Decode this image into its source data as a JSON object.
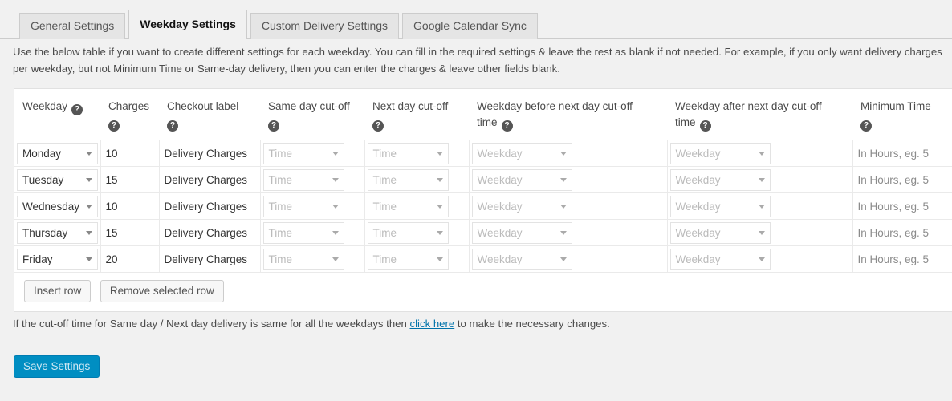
{
  "tabs": [
    {
      "label": "General Settings",
      "active": false
    },
    {
      "label": "Weekday Settings",
      "active": true
    },
    {
      "label": "Custom Delivery Settings",
      "active": false
    },
    {
      "label": "Google Calendar Sync",
      "active": false
    }
  ],
  "intro": "Use the below table if you want to create different settings for each weekday. You can fill in the required settings & leave the rest as blank if not needed. For example, if you only want delivery charges per weekday, but not Minimum Time or Same-day delivery, then you can enter the charges & leave other fields blank.",
  "table": {
    "headers": [
      {
        "label": "Weekday",
        "help": "help-icon"
      },
      {
        "label": "Charges",
        "help": "help-icon"
      },
      {
        "label": "Checkout label",
        "help": "help-icon"
      },
      {
        "label": "Same day cut-off",
        "help": "help-icon"
      },
      {
        "label": "Next day cut-off",
        "help": "help-icon"
      },
      {
        "label": "Weekday before next day cut-off time",
        "help": "help-icon"
      },
      {
        "label": "Weekday after next day cut-off time",
        "help": "help-icon"
      },
      {
        "label": "Minimum Time",
        "help": "help-icon"
      }
    ],
    "rows": [
      {
        "weekday": "Monday",
        "charges": "10",
        "checkout_label": "Delivery Charges",
        "same_day_cutoff": "Time",
        "next_day_cutoff": "Time",
        "weekday_before": "Weekday",
        "weekday_after": "Weekday",
        "minimum_time": "In Hours, eg. 5"
      },
      {
        "weekday": "Tuesday",
        "charges": "15",
        "checkout_label": "Delivery Charges",
        "same_day_cutoff": "Time",
        "next_day_cutoff": "Time",
        "weekday_before": "Weekday",
        "weekday_after": "Weekday",
        "minimum_time": "In Hours, eg. 5"
      },
      {
        "weekday": "Wednesday",
        "charges": "10",
        "checkout_label": "Delivery Charges",
        "same_day_cutoff": "Time",
        "next_day_cutoff": "Time",
        "weekday_before": "Weekday",
        "weekday_after": "Weekday",
        "minimum_time": "In Hours, eg. 5"
      },
      {
        "weekday": "Thursday",
        "charges": "15",
        "checkout_label": "Delivery Charges",
        "same_day_cutoff": "Time",
        "next_day_cutoff": "Time",
        "weekday_before": "Weekday",
        "weekday_after": "Weekday",
        "minimum_time": "In Hours, eg. 5"
      },
      {
        "weekday": "Friday",
        "charges": "20",
        "checkout_label": "Delivery Charges",
        "same_day_cutoff": "Time",
        "next_day_cutoff": "Time",
        "weekday_before": "Weekday",
        "weekday_after": "Weekday",
        "minimum_time": "In Hours, eg. 5"
      }
    ]
  },
  "row_actions": {
    "insert": "Insert row",
    "remove": "Remove selected row"
  },
  "note": {
    "before_link": "If the cut-off time for Same day / Next day delivery is same for all the weekdays then ",
    "link": "click here",
    "after_link": " to make the necessary changes."
  },
  "save_button": "Save Settings",
  "icons": {
    "help": "?",
    "dropdown": "chevron-down-icon"
  },
  "colors": {
    "page_background": "#f1f1f1",
    "primary": "#008ec2",
    "link": "#0073aa",
    "placeholder": "#bbbbbb"
  }
}
